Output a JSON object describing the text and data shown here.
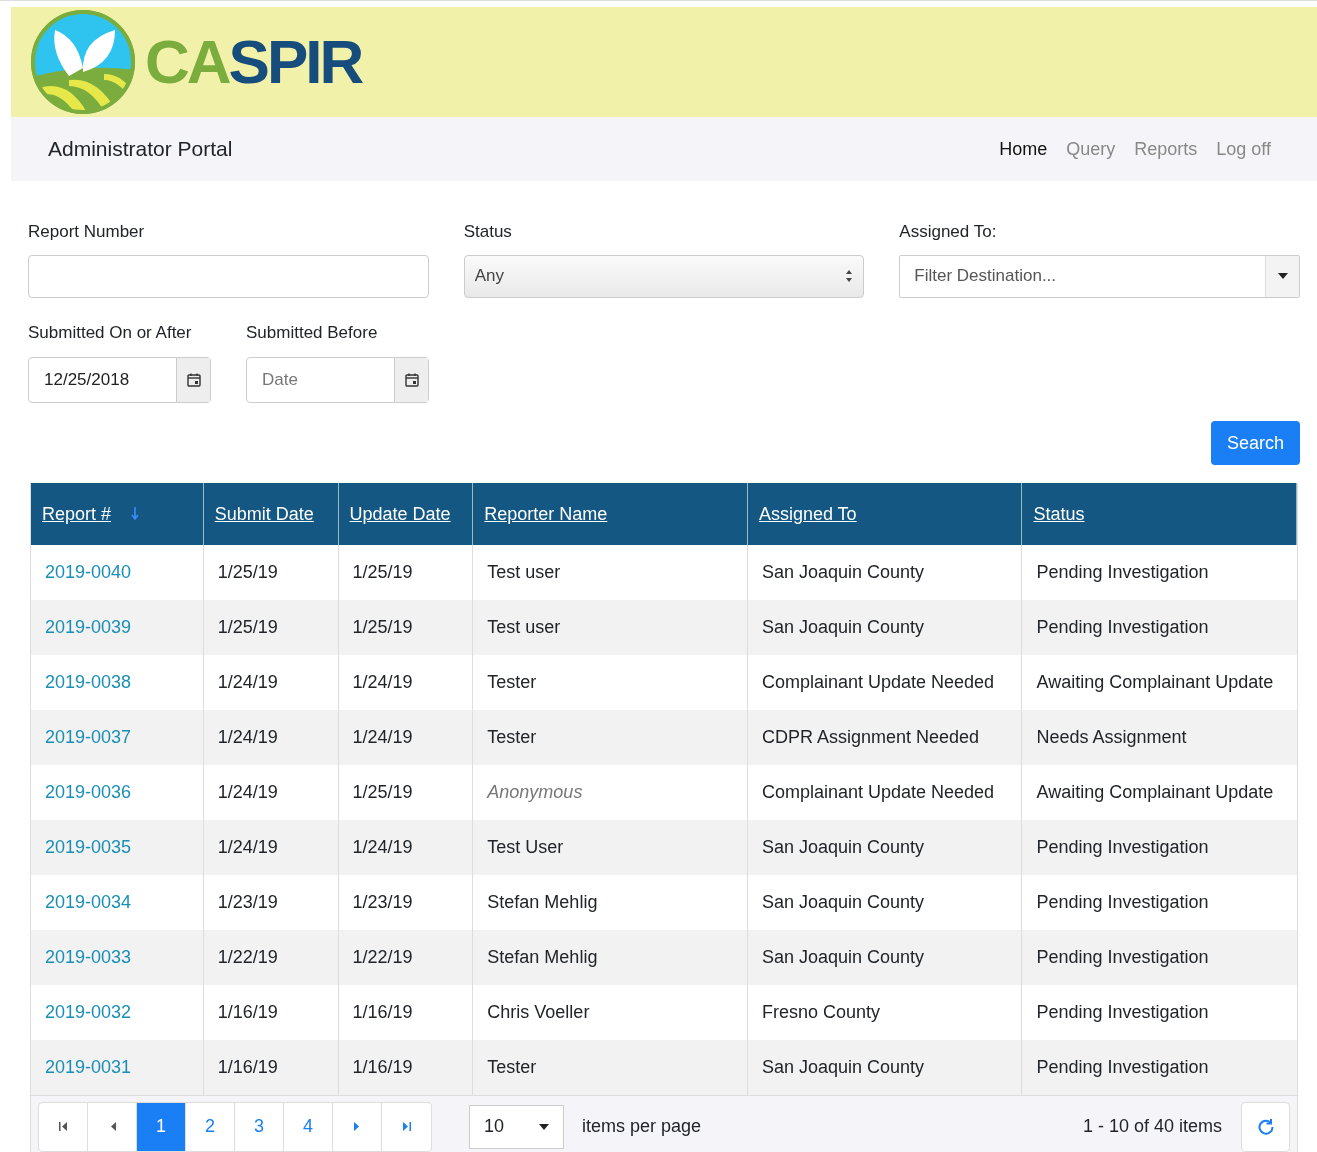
{
  "logo": {
    "prefix": "CA",
    "suffix": "SPIR"
  },
  "portal_title": "Administrator Portal",
  "nav": [
    {
      "label": "Home",
      "selected": true
    },
    {
      "label": "Query",
      "selected": false
    },
    {
      "label": "Reports",
      "selected": false
    },
    {
      "label": "Log off",
      "selected": false
    }
  ],
  "filters": {
    "report_number": {
      "label": "Report Number"
    },
    "status": {
      "label": "Status",
      "value": "Any"
    },
    "assigned_to": {
      "label": "Assigned To:",
      "placeholder": "Filter Destination..."
    },
    "submitted_after": {
      "label": "Submitted On or After",
      "value": "12/25/2018"
    },
    "submitted_before": {
      "label": "Submitted Before",
      "placeholder": "Date"
    },
    "search_button": "Search"
  },
  "table": {
    "columns": [
      {
        "label": "Report #",
        "sorted": true
      },
      {
        "label": "Submit Date",
        "sorted": false
      },
      {
        "label": "Update Date",
        "sorted": false
      },
      {
        "label": "Reporter Name",
        "sorted": false
      },
      {
        "label": "Assigned To",
        "sorted": false
      },
      {
        "label": "Status",
        "sorted": false
      }
    ],
    "rows": [
      {
        "report": "2019-0040",
        "submit": "1/25/19",
        "update": "1/25/19",
        "reporter": "Test user",
        "anonymous": false,
        "assigned": "San Joaquin County",
        "status": "Pending Investigation"
      },
      {
        "report": "2019-0039",
        "submit": "1/25/19",
        "update": "1/25/19",
        "reporter": "Test user",
        "anonymous": false,
        "assigned": "San Joaquin County",
        "status": "Pending Investigation"
      },
      {
        "report": "2019-0038",
        "submit": "1/24/19",
        "update": "1/24/19",
        "reporter": "Tester",
        "anonymous": false,
        "assigned": "Complainant Update Needed",
        "status": "Awaiting Complainant Update"
      },
      {
        "report": "2019-0037",
        "submit": "1/24/19",
        "update": "1/24/19",
        "reporter": "Tester",
        "anonymous": false,
        "assigned": "CDPR Assignment Needed",
        "status": "Needs Assignment"
      },
      {
        "report": "2019-0036",
        "submit": "1/24/19",
        "update": "1/25/19",
        "reporter": "Anonymous",
        "anonymous": true,
        "assigned": "Complainant Update Needed",
        "status": "Awaiting Complainant Update"
      },
      {
        "report": "2019-0035",
        "submit": "1/24/19",
        "update": "1/24/19",
        "reporter": "Test User",
        "anonymous": false,
        "assigned": "San Joaquin County",
        "status": "Pending Investigation"
      },
      {
        "report": "2019-0034",
        "submit": "1/23/19",
        "update": "1/23/19",
        "reporter": "Stefan Mehlig",
        "anonymous": false,
        "assigned": "San Joaquin County",
        "status": "Pending Investigation"
      },
      {
        "report": "2019-0033",
        "submit": "1/22/19",
        "update": "1/22/19",
        "reporter": "Stefan Mehlig",
        "anonymous": false,
        "assigned": "San Joaquin County",
        "status": "Pending Investigation"
      },
      {
        "report": "2019-0032",
        "submit": "1/16/19",
        "update": "1/16/19",
        "reporter": "Chris Voeller",
        "anonymous": false,
        "assigned": "Fresno County",
        "status": "Pending Investigation"
      },
      {
        "report": "2019-0031",
        "submit": "1/16/19",
        "update": "1/16/19",
        "reporter": "Tester",
        "anonymous": false,
        "assigned": "San Joaquin County",
        "status": "Pending Investigation"
      }
    ]
  },
  "pager": {
    "pages": [
      {
        "label": "1",
        "selected": true
      },
      {
        "label": "2",
        "selected": false
      },
      {
        "label": "3",
        "selected": false
      },
      {
        "label": "4",
        "selected": false
      }
    ],
    "page_size": "10",
    "page_size_label": "items per page",
    "summary": "1 - 10 of 40 items"
  }
}
